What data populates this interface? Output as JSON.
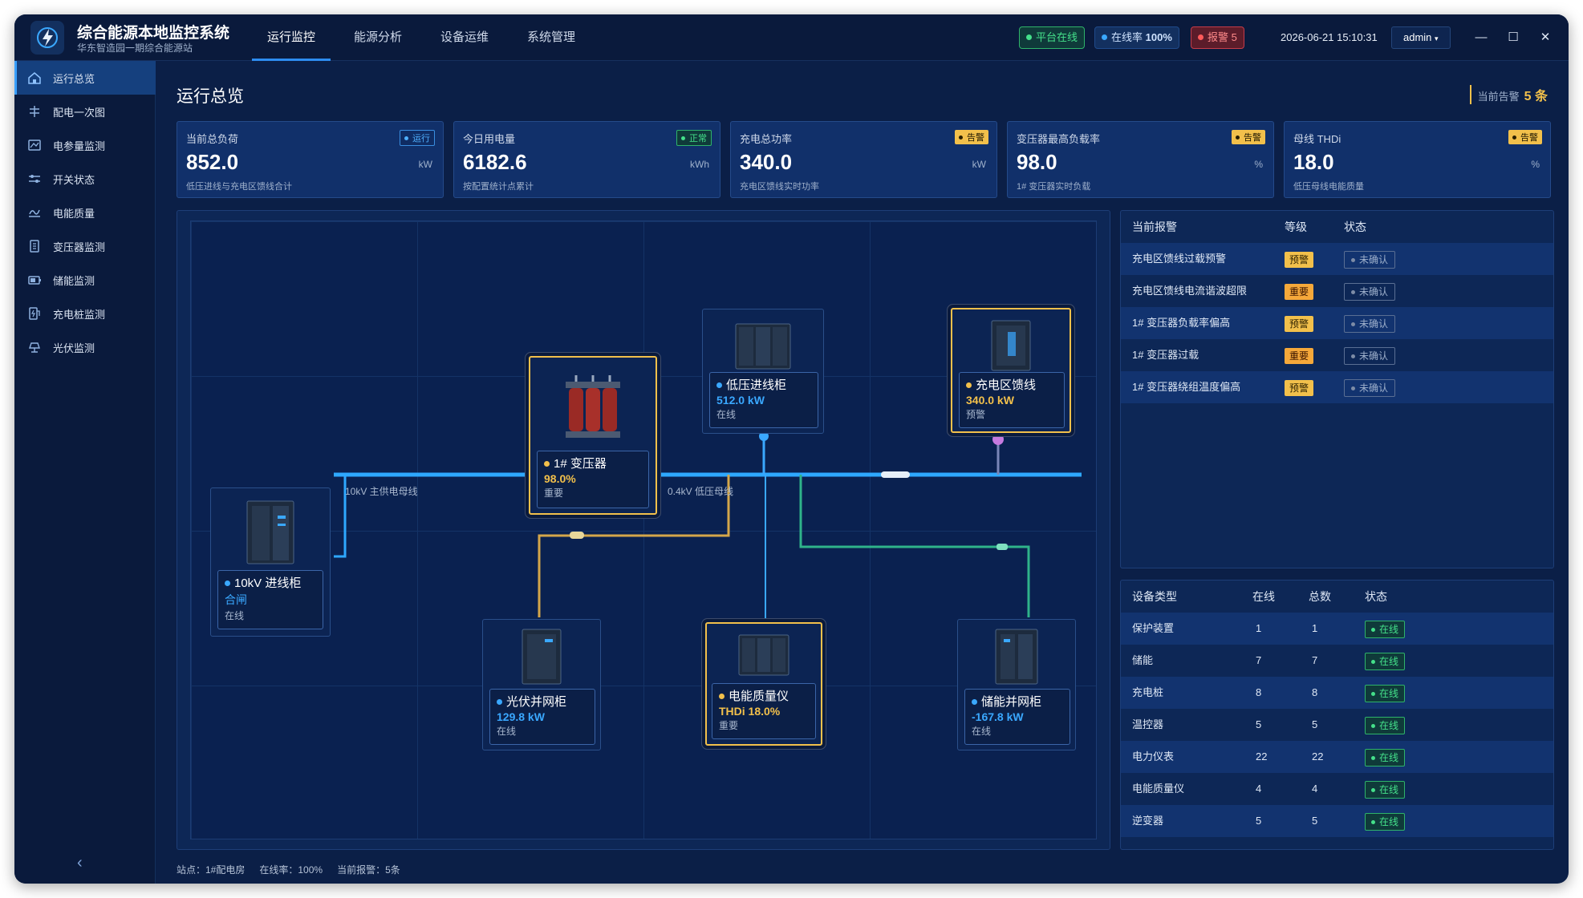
{
  "header": {
    "title": "综合能源本地监控系统",
    "subtitle": "华东智造园一期综合能源站",
    "tabs": [
      "运行监控",
      "能源分析",
      "设备运维",
      "系统管理"
    ],
    "platform_status": "平台在线",
    "online_rate_label": "在线率",
    "online_rate_value": "100%",
    "alarm_label": "报警",
    "alarm_count": "5",
    "datetime": "2026-06-21 15:10:31",
    "user": "admin"
  },
  "sidebar": {
    "items": [
      "运行总览",
      "配电一次图",
      "电参量监测",
      "开关状态",
      "电能质量",
      "变压器监测",
      "储能监测",
      "充电桩监测",
      "光伏监测"
    ],
    "active_index": 0
  },
  "page": {
    "title": "运行总览",
    "current_alarm_label": "当前告警",
    "current_alarm_value": "5 条"
  },
  "kpis": [
    {
      "label": "当前总负荷",
      "badge": "运行",
      "value": "852.0",
      "unit": "kW",
      "desc": "低压进线与充电区馈线合计"
    },
    {
      "label": "今日用电量",
      "badge": "正常",
      "value": "6182.6",
      "unit": "kWh",
      "desc": "按配置统计点累计"
    },
    {
      "label": "充电总功率",
      "badge": "告警",
      "value": "340.0",
      "unit": "kW",
      "desc": "充电区馈线实时功率"
    },
    {
      "label": "变压器最高负载率",
      "badge": "告警",
      "value": "98.0",
      "unit": "%",
      "desc": "1# 变压器实时负载"
    },
    {
      "label": "母线 THDi",
      "badge": "告警",
      "value": "18.0",
      "unit": "%",
      "desc": "低压母线电能质量"
    }
  ],
  "diagram": {
    "bus_hv_label": "10kV 主供电母线",
    "bus_lv_label": "0.4kV 低压母线",
    "devices": {
      "incoming10kv": {
        "name": "10kV 进线柜",
        "value": "合闸",
        "status": "在线"
      },
      "transformer": {
        "name": "1# 变压器",
        "value": "98.0%",
        "status": "重要"
      },
      "lvincoming": {
        "name": "低压进线柜",
        "value": "512.0 kW",
        "status": "在线"
      },
      "chargefeeder": {
        "name": "充电区馈线",
        "value": "340.0 kW",
        "status": "预警"
      },
      "pv": {
        "name": "光伏并网柜",
        "value": "129.8 kW",
        "status": "在线"
      },
      "pq": {
        "name": "电能质量仪",
        "value": "THDi 18.0%",
        "status": "重要"
      },
      "storage": {
        "name": "储能并网柜",
        "value": "-167.8 kW",
        "status": "在线"
      }
    }
  },
  "alarms": {
    "headers": [
      "当前报警",
      "等级",
      "状态"
    ],
    "rows": [
      {
        "name": "充电区馈线过载预警",
        "level": "预警",
        "status": "未确认"
      },
      {
        "name": "充电区馈线电流谐波超限",
        "level": "重要",
        "status": "未确认"
      },
      {
        "name": "1# 变压器负载率偏高",
        "level": "预警",
        "status": "未确认"
      },
      {
        "name": "1# 变压器过载",
        "level": "重要",
        "status": "未确认"
      },
      {
        "name": "1# 变压器绕组温度偏高",
        "level": "预警",
        "status": "未确认"
      }
    ]
  },
  "devices": {
    "headers": [
      "设备类型",
      "在线",
      "总数",
      "状态"
    ],
    "rows": [
      {
        "type": "保护装置",
        "online": "1",
        "total": "1",
        "status": "在线"
      },
      {
        "type": "储能",
        "online": "7",
        "total": "7",
        "status": "在线"
      },
      {
        "type": "充电桩",
        "online": "8",
        "total": "8",
        "status": "在线"
      },
      {
        "type": "温控器",
        "online": "5",
        "total": "5",
        "status": "在线"
      },
      {
        "type": "电力仪表",
        "online": "22",
        "total": "22",
        "status": "在线"
      },
      {
        "type": "电能质量仪",
        "online": "4",
        "total": "4",
        "status": "在线"
      },
      {
        "type": "逆变器",
        "online": "5",
        "total": "5",
        "status": "在线"
      }
    ]
  },
  "statusbar": {
    "station": "站点：1#配电房",
    "online_rate": "在线率：100%",
    "alarms": "当前报警：5条"
  },
  "colors": {
    "background": "#0b1f47",
    "accent": "#2d8cf0",
    "bus_blue": "#2ea8ff",
    "warning": "#f2c04b",
    "online_green": "#44e08a",
    "alarm_red": "#e04a4a"
  }
}
